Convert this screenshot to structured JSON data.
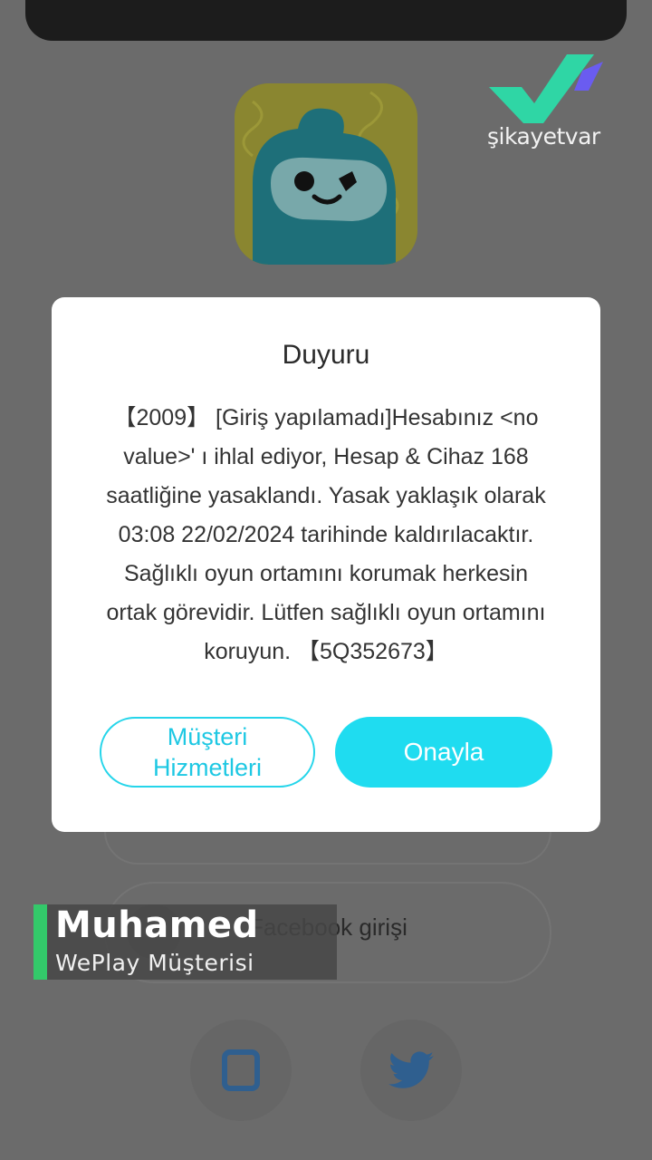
{
  "brand": {
    "name": "şikayetvar",
    "logo_icon": "checkmark-logo-icon"
  },
  "app_icon": {
    "icon": "weplay-mascot-icon"
  },
  "dialog": {
    "title": "Duyuru",
    "body": "【2009】 [Giriş yapılamadı]Hesabınız <no\nvalue>' ı ihlal ediyor,  Hesap & Cihaz 168\nsaatliğine yasaklandı. Yasak yaklaşık olarak\n03:08 22/02/2024 tarihinde kaldırılacaktır.\nSağlıklı oyun ortamını korumak herkesin\nortak görevidir. Lütfen sağlıklı oyun ortamını\nkoruyun. 【5Q352673】",
    "secondary_button": "Müşteri\nHizmetleri",
    "primary_button": "Onayla",
    "accent_color": "#1fdcf0"
  },
  "background": {
    "facebook_label": "Facebook girişi",
    "social_icons": [
      "tablet-icon",
      "twitter-icon"
    ]
  },
  "caption": {
    "name": "Muhamed",
    "subtitle": "WePlay Müşterisi",
    "accent_color": "#33c96a"
  }
}
